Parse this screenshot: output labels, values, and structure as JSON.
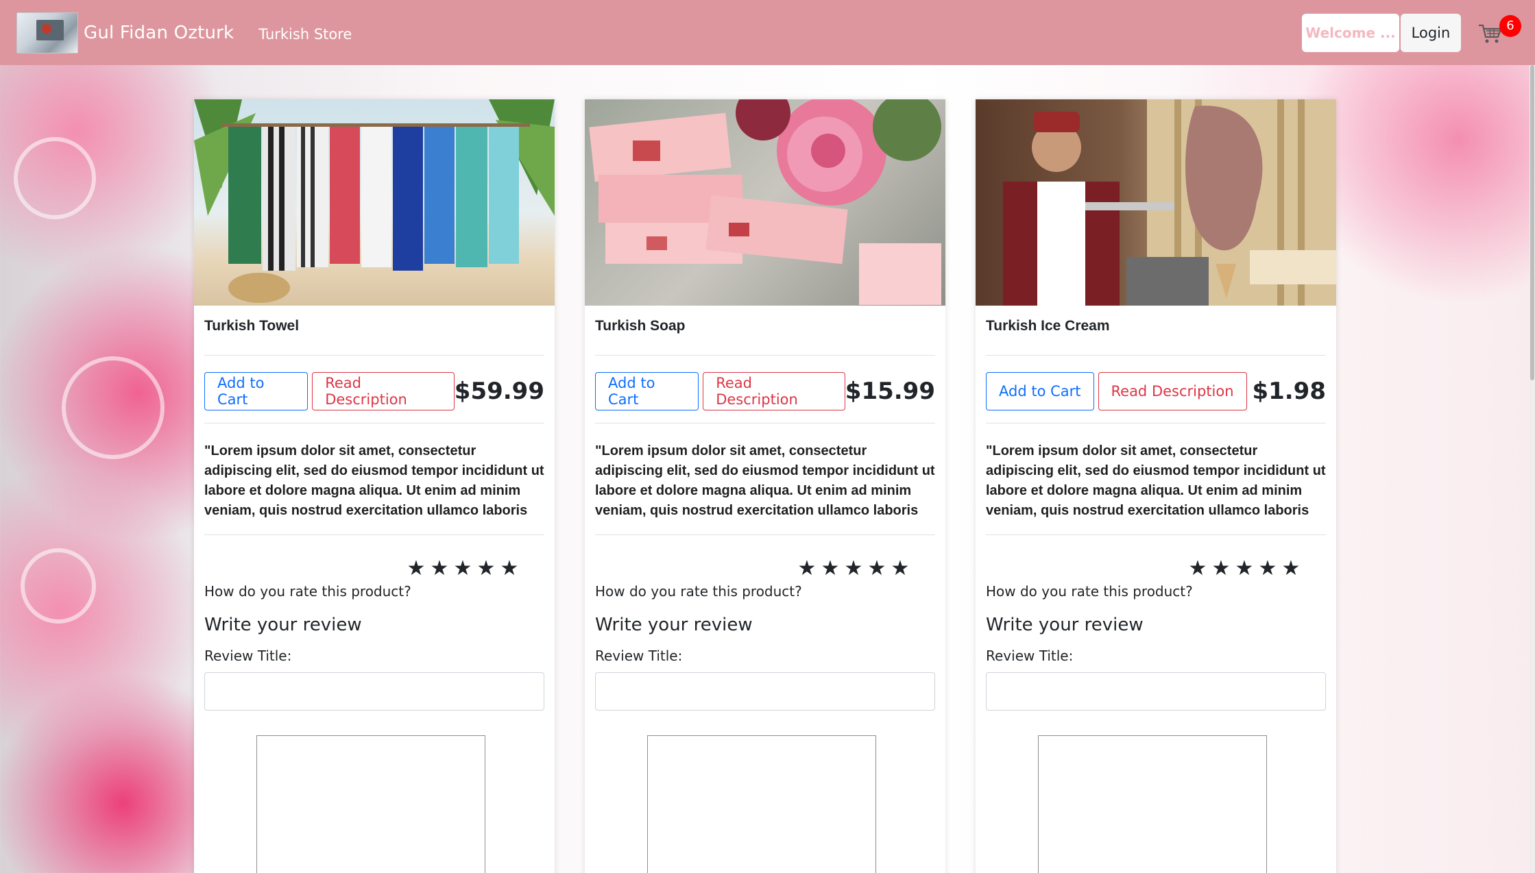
{
  "navbar": {
    "brand": "Gul Fidan Ozturk",
    "store_link": "Turkish Store",
    "welcome": "Welcome ...",
    "login": "Login",
    "cart_count": "6"
  },
  "colors": {
    "navbar": "#dd969e",
    "primary": "#0d6efd",
    "danger": "#dc3545",
    "badge": "#ff0000"
  },
  "products": [
    {
      "title": "Turkish Towel",
      "add_to_cart": "Add to Cart",
      "read_description": "Read Description",
      "price": "$59.99",
      "description": "\"Lorem ipsum dolor sit amet, consectetur adipiscing elit, sed do eiusmod tempor incididunt ut labore et dolore magna aliqua. Ut enim ad minim veniam, quis nostrud exercitation ullamco laboris nisi ut",
      "rate_question": "How do you rate this product?",
      "review_heading": "Write your review",
      "review_title_label": "Review Title:"
    },
    {
      "title": "Turkish Soap",
      "add_to_cart": "Add to Cart",
      "read_description": "Read Description",
      "price": "$15.99",
      "description": "\"Lorem ipsum dolor sit amet, consectetur adipiscing elit, sed do eiusmod tempor incididunt ut labore et dolore magna aliqua. Ut enim ad minim veniam, quis nostrud exercitation ullamco laboris nisi ut",
      "rate_question": "How do you rate this product?",
      "review_heading": "Write your review",
      "review_title_label": "Review Title:"
    },
    {
      "title": "Turkish Ice Cream",
      "add_to_cart": "Add to Cart",
      "read_description": "Read Description",
      "price": "$1.98",
      "description": "\"Lorem ipsum dolor sit amet, consectetur adipiscing elit, sed do eiusmod tempor incididunt ut labore et dolore magna aliqua. Ut enim ad minim veniam, quis nostrud exercitation ullamco laboris nisi ut",
      "rate_question": "How do you rate this product?",
      "review_heading": "Write your review",
      "review_title_label": "Review Title:"
    }
  ]
}
